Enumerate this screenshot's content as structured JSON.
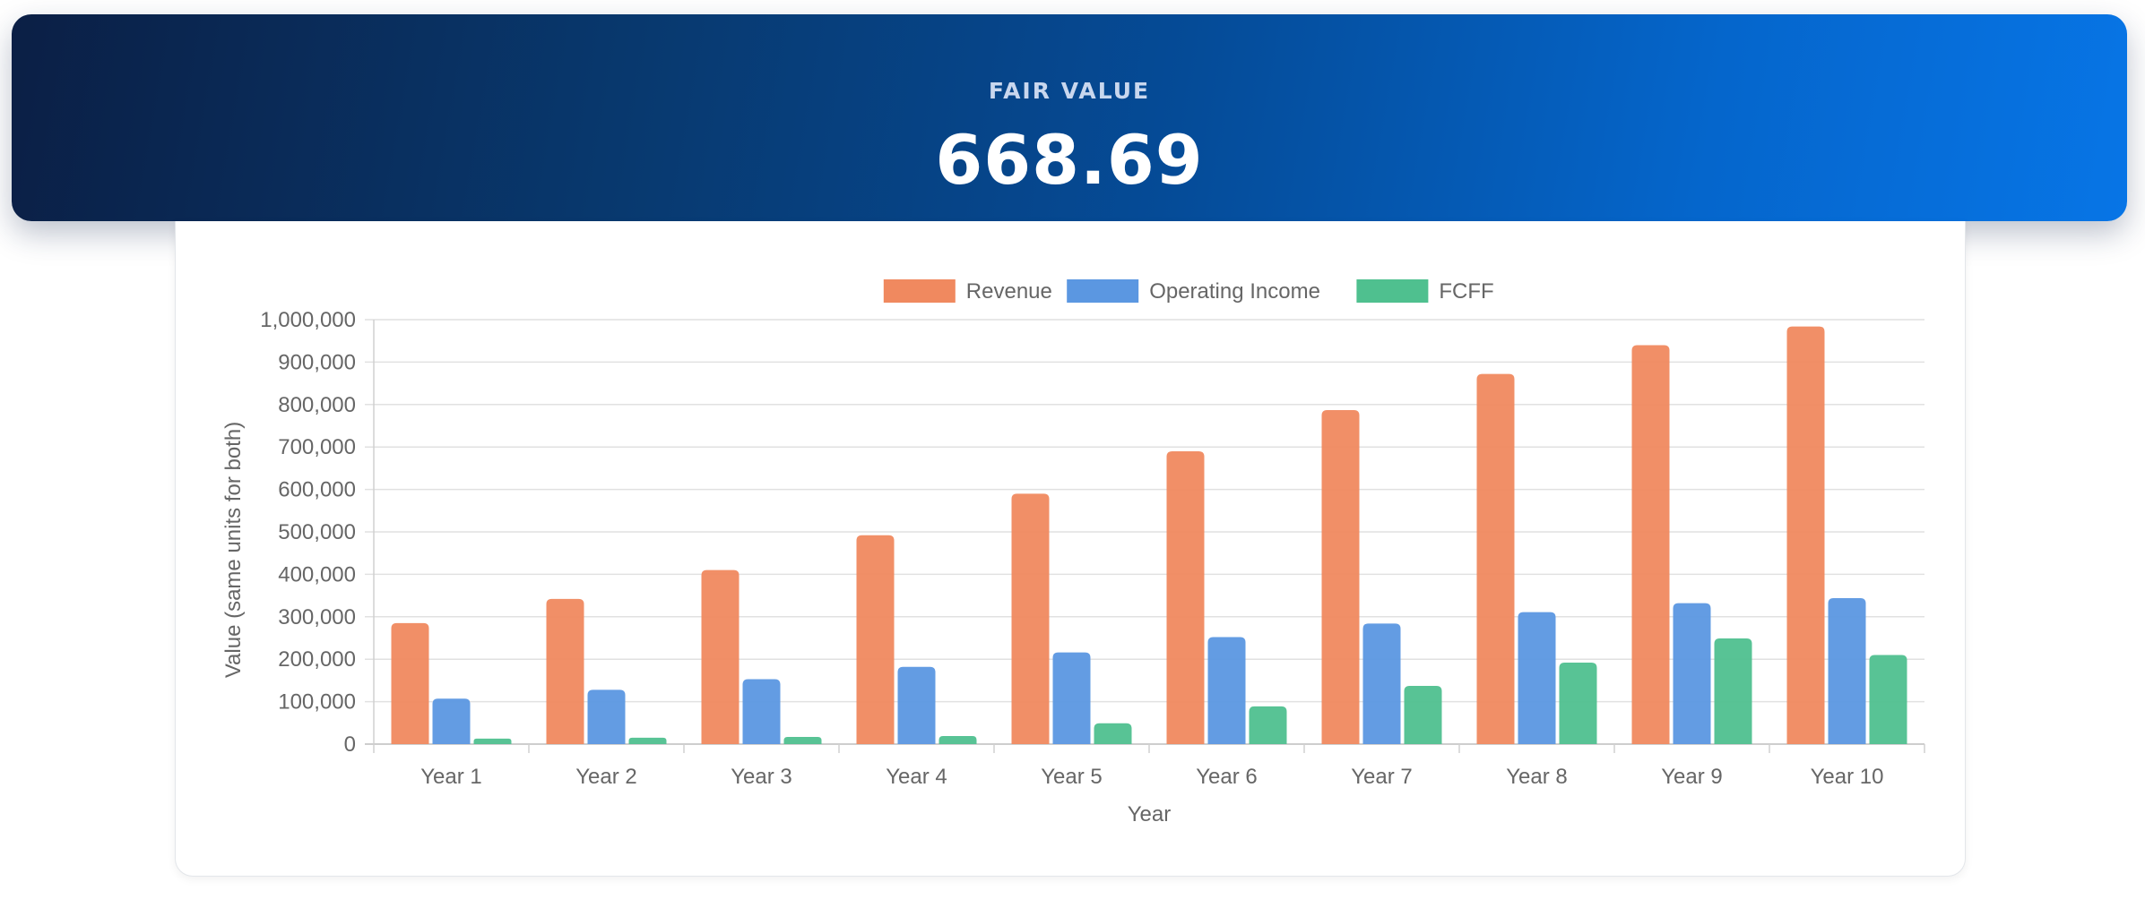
{
  "header": {
    "label": "FAIR VALUE",
    "value": "668.69"
  },
  "colors": {
    "revenue": "#f0895f",
    "operating_income": "#5b97e1",
    "fcff": "#4fc08f",
    "banner_start": "#0b1f45",
    "banner_end": "#0775e6"
  },
  "chart_data": {
    "type": "bar",
    "categories": [
      "Year 1",
      "Year 2",
      "Year 3",
      "Year 4",
      "Year 5",
      "Year 6",
      "Year 7",
      "Year 8",
      "Year 9",
      "Year 10"
    ],
    "series": [
      {
        "name": "Revenue",
        "color": "#f0895f",
        "values": [
          285000,
          342000,
          410000,
          492000,
          590000,
          690000,
          787000,
          872000,
          940000,
          984000
        ]
      },
      {
        "name": "Operating Income",
        "color": "#5b97e1",
        "values": [
          107000,
          128000,
          153000,
          182000,
          216000,
          252000,
          284000,
          311000,
          332000,
          344000
        ]
      },
      {
        "name": "FCFF",
        "color": "#4fc08f",
        "values": [
          13000,
          15000,
          17000,
          19000,
          49000,
          89000,
          137000,
          192000,
          249000,
          210000
        ]
      }
    ],
    "xlabel": "Year",
    "ylabel": "Value (same units for both)",
    "ylim": [
      0,
      1000000
    ],
    "yticks": [
      "0",
      "100,000",
      "200,000",
      "300,000",
      "400,000",
      "500,000",
      "600,000",
      "700,000",
      "800,000",
      "900,000",
      "1,000,000"
    ],
    "grid": true,
    "legend_position": "top-center"
  }
}
